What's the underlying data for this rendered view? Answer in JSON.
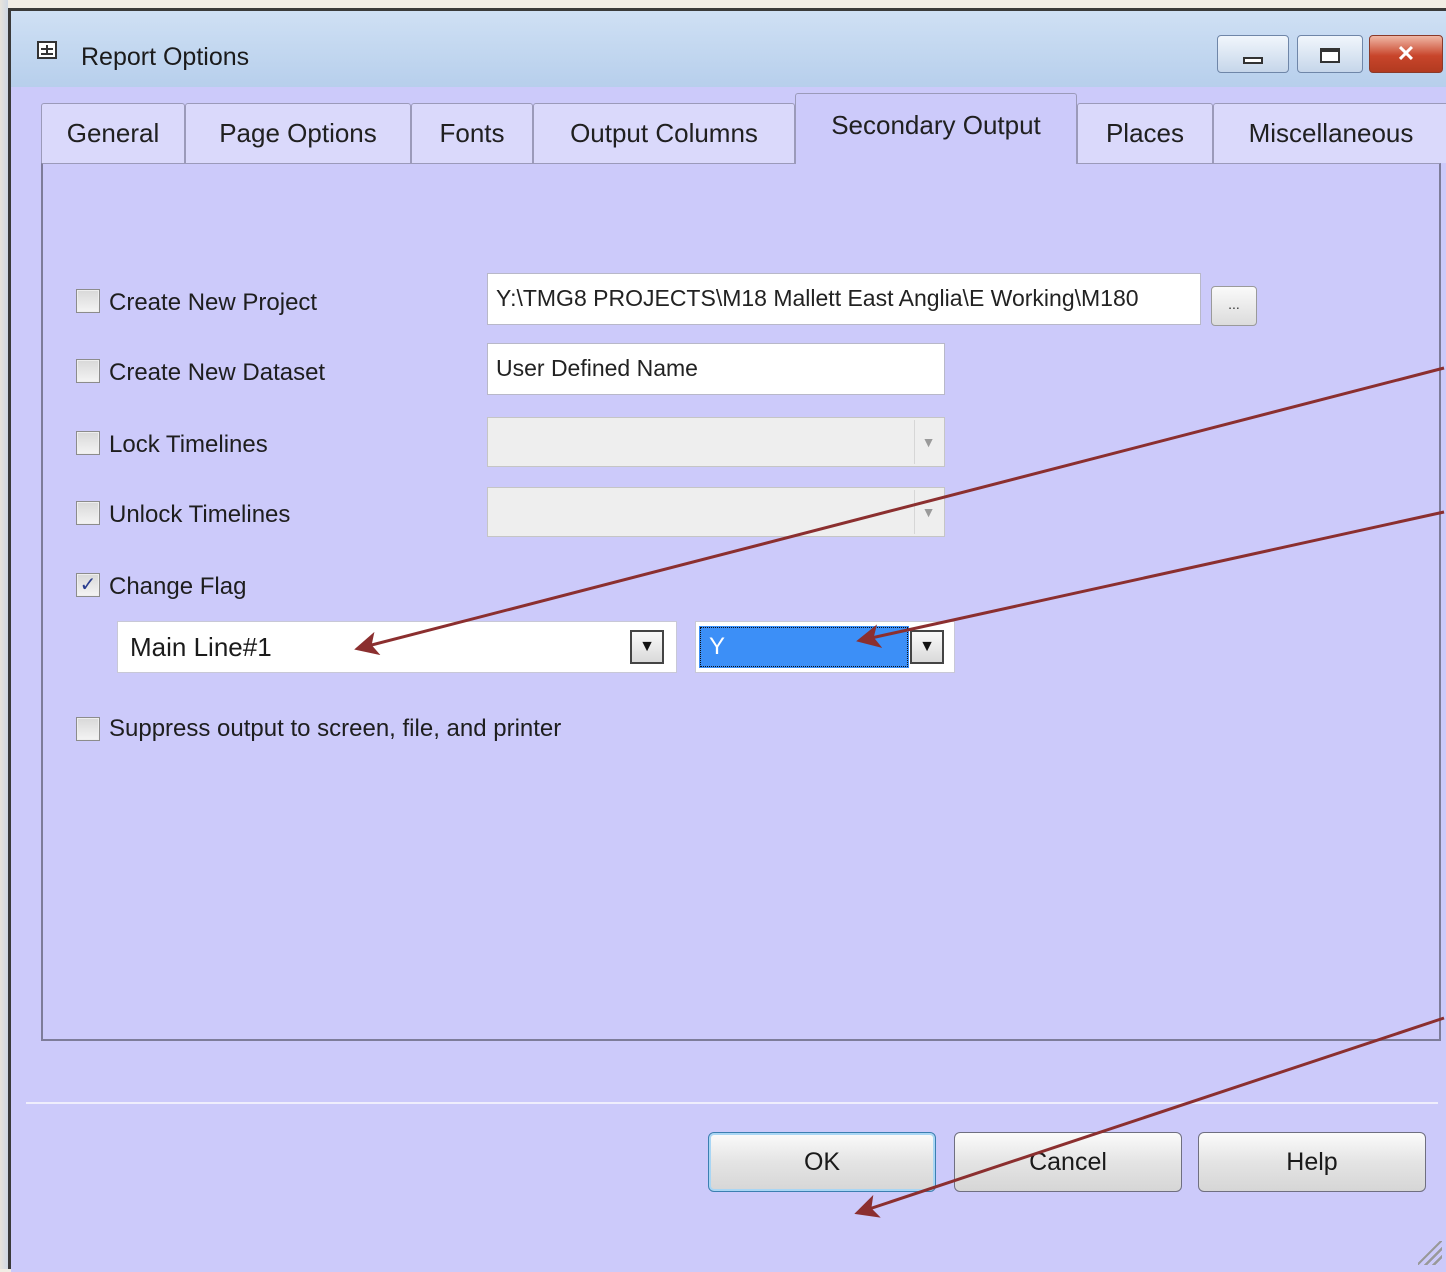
{
  "window": {
    "title": "Report Options",
    "accent": "#cccafa"
  },
  "tabs": [
    {
      "label": "General"
    },
    {
      "label": "Page Options"
    },
    {
      "label": "Fonts"
    },
    {
      "label": "Output Columns"
    },
    {
      "label": "Secondary Output",
      "active": true
    },
    {
      "label": "Places"
    },
    {
      "label": "Miscellaneous"
    }
  ],
  "options": {
    "create_project": {
      "label": "Create New Project",
      "checked": false,
      "path": "Y:\\TMG8 PROJECTS\\M18 Mallett East Anglia\\E Working\\M180",
      "browse_label": "..."
    },
    "create_dataset": {
      "label": "Create New Dataset",
      "checked": false,
      "value": "User Defined Name"
    },
    "lock_timelines": {
      "label": "Lock Timelines",
      "checked": false,
      "value": ""
    },
    "unlock_timelines": {
      "label": "Unlock Timelines",
      "checked": false,
      "value": ""
    },
    "change_flag": {
      "label": "Change Flag",
      "checked": true,
      "check_mark": "✓",
      "flag_field": "Main Line#1",
      "flag_value": "Y"
    },
    "suppress": {
      "label": "Suppress output to screen, file, and printer",
      "checked": false
    }
  },
  "buttons": {
    "ok": "OK",
    "cancel": "Cancel",
    "help": "Help"
  },
  "annotation_color": "#8b2f2f"
}
